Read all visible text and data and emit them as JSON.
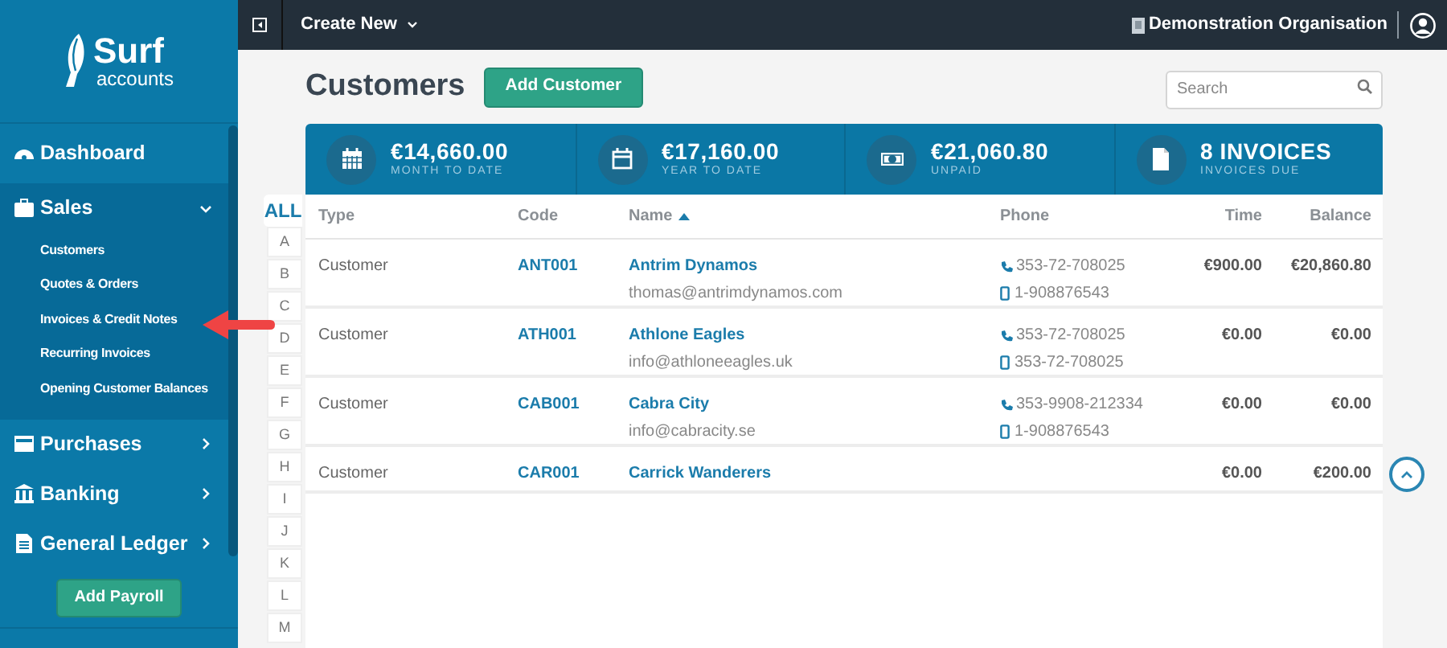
{
  "sidebar": {
    "logo": {
      "title": "Surf",
      "subtitle": "accounts"
    },
    "items": [
      {
        "label": "Dashboard",
        "kind": "link"
      },
      {
        "label": "Sales",
        "kind": "group",
        "expanded": true,
        "children": [
          "Customers",
          "Quotes & Orders",
          "Invoices & Credit Notes",
          "Recurring Invoices",
          "Opening Customer Balances"
        ]
      },
      {
        "label": "Purchases",
        "kind": "group",
        "expanded": false
      },
      {
        "label": "Banking",
        "kind": "group",
        "expanded": false
      },
      {
        "label": "General Ledger",
        "kind": "group",
        "expanded": false
      }
    ],
    "action_button": "Add Payroll"
  },
  "top_bar": {
    "create_new": "Create New",
    "organisation": "Demonstration Organisation"
  },
  "page": {
    "title": "Customers",
    "add_button": "Add Customer",
    "search": {
      "placeholder": "Search"
    }
  },
  "stats": [
    {
      "value": "€14,660.00",
      "label": "MONTH TO DATE"
    },
    {
      "value": "€17,160.00",
      "label": "YEAR TO DATE"
    },
    {
      "value": "€21,060.80",
      "label": "UNPAID"
    },
    {
      "value": "8 INVOICES",
      "label": "INVOICES DUE"
    }
  ],
  "letters": [
    {
      "label": "ALL",
      "selected": true
    },
    {
      "label": "A",
      "selected": false
    },
    {
      "label": "B",
      "selected": false
    },
    {
      "label": "C",
      "selected": false
    },
    {
      "label": "D",
      "selected": false
    },
    {
      "label": "E",
      "selected": false
    },
    {
      "label": "F",
      "selected": false
    },
    {
      "label": "G",
      "selected": false
    },
    {
      "label": "H",
      "selected": false
    },
    {
      "label": "I",
      "selected": false
    },
    {
      "label": "J",
      "selected": false
    },
    {
      "label": "K",
      "selected": false
    },
    {
      "label": "L",
      "selected": false
    },
    {
      "label": "M",
      "selected": false
    }
  ],
  "table": {
    "columns": [
      {
        "label": "Type",
        "sorted": false
      },
      {
        "label": "Code",
        "sorted": false
      },
      {
        "label": "Name",
        "sorted": true
      },
      {
        "label": "Phone",
        "sorted": false
      },
      {
        "label": "Time",
        "sorted": false
      },
      {
        "label": "Balance",
        "sorted": false
      }
    ],
    "rows": [
      {
        "type": "Customer",
        "code": "ANT001",
        "name": "Antrim Dynamos",
        "email": "thomas@antrimdynamos.com",
        "phone": "353-72-708025",
        "mobile": "1-908876543",
        "time": "€900.00",
        "balance": "€20,860.80"
      },
      {
        "type": "Customer",
        "code": "ATH001",
        "name": "Athlone Eagles",
        "email": "info@athloneeagles.uk",
        "phone": "353-72-708025",
        "mobile": "353-72-708025",
        "time": "€0.00",
        "balance": "€0.00"
      },
      {
        "type": "Customer",
        "code": "CAB001",
        "name": "Cabra City",
        "email": "info@cabracity.se",
        "phone": "353-9908-212334",
        "mobile": "1-908876543",
        "time": "€0.00",
        "balance": "€0.00"
      },
      {
        "type": "Customer",
        "code": "CAR001",
        "name": "Carrick Wanderers",
        "time": "€0.00",
        "balance": "€200.00"
      }
    ]
  }
}
